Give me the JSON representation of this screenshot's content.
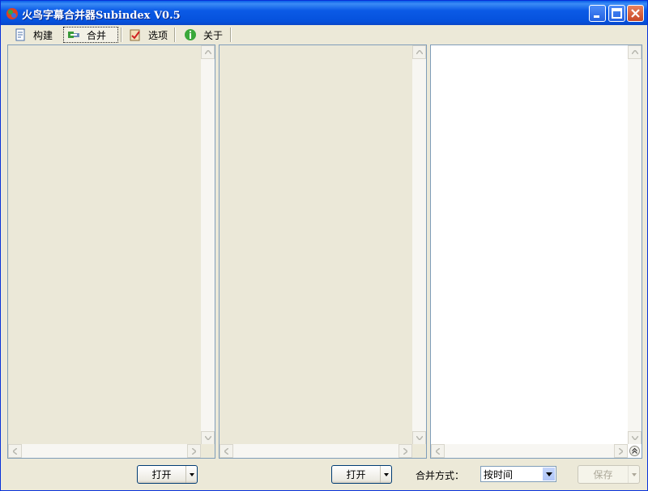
{
  "window": {
    "title": "火鸟字幕合并器Subindex V0.5"
  },
  "toolbar": {
    "tabs": [
      {
        "label": "构建",
        "icon": "document-icon"
      },
      {
        "label": "合并",
        "icon": "merge-icon"
      },
      {
        "label": "选项",
        "icon": "clipboard-check-icon"
      },
      {
        "label": "关于",
        "icon": "info-icon"
      }
    ],
    "active_tab": "合并"
  },
  "bottom": {
    "open_left_label": "打开",
    "open_mid_label": "打开",
    "merge_mode_label": "合并方式：",
    "merge_mode_value": "按时间",
    "save_label": "保存"
  }
}
